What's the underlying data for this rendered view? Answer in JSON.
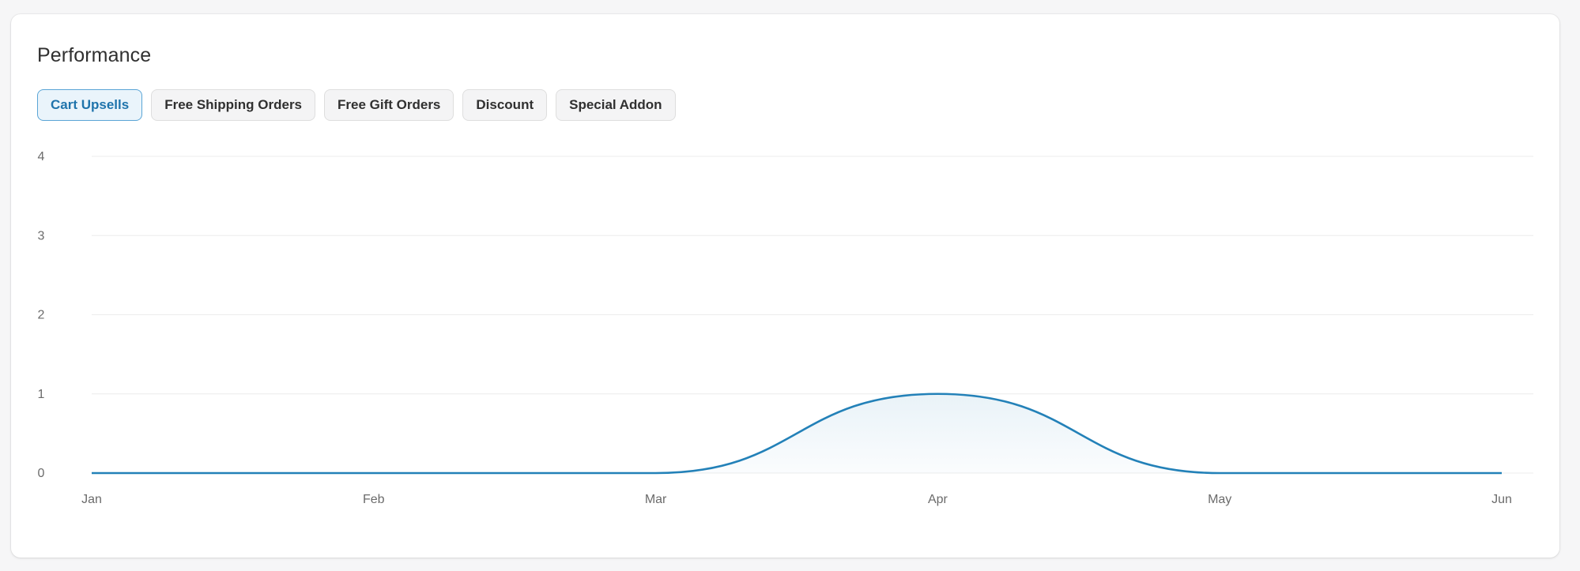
{
  "title": "Performance",
  "tabs": [
    {
      "label": "Cart Upsells",
      "active": true
    },
    {
      "label": "Free Shipping Orders",
      "active": false
    },
    {
      "label": "Free Gift Orders",
      "active": false
    },
    {
      "label": "Discount",
      "active": false
    },
    {
      "label": "Special Addon",
      "active": false
    }
  ],
  "colors": {
    "line": "#2381b8",
    "grid": "#ececec",
    "active_tab_border": "#5aa5d6",
    "active_tab_text": "#1f74ac"
  },
  "chart_data": {
    "type": "area",
    "categories": [
      "Jan",
      "Feb",
      "Mar",
      "Apr",
      "May",
      "Jun"
    ],
    "values": [
      0,
      0,
      0,
      1,
      0,
      0
    ],
    "y_ticks": [
      "0",
      "1",
      "2",
      "3",
      "4"
    ],
    "ylim": [
      0,
      4
    ],
    "grid": true,
    "legend": "none",
    "curve": "smooth"
  }
}
